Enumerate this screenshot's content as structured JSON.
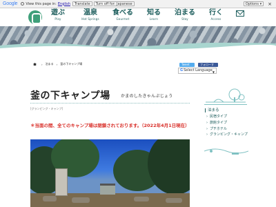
{
  "translate_bar": {
    "google": "Google",
    "view_text": "View this page in:",
    "language": "English",
    "translate_label": "Translate",
    "turn_off_label": "Turn off for: Japanese",
    "options_label": "Options ▾",
    "close_label": "×"
  },
  "nav": {
    "items": [
      {
        "jp": "遊ぶ",
        "en": "Play"
      },
      {
        "jp": "温泉",
        "en": "Hot Springs"
      },
      {
        "jp": "食べる",
        "en": "Gourmet"
      },
      {
        "jp": "知る",
        "en": "Learn"
      },
      {
        "jp": "泊まる",
        "en": "Stay"
      },
      {
        "jp": "行く",
        "en": "Access"
      }
    ]
  },
  "breadcrumb": {
    "parent": "泊まる",
    "current": "釜の下キャンプ場"
  },
  "share": {
    "tweet": "Tweet",
    "facebook": "フォローする"
  },
  "language_select": {
    "value": "Select Language",
    "google_g": "G"
  },
  "page": {
    "title": "釜の下キャンプ場",
    "title_kana": "かまのしたきゃんぷじょう",
    "category": "[グランピング・キャンプ]",
    "notice": "＊当面の間、全てのキャンプ場は閉鎖されております。（2022年4月1日現在）"
  },
  "sidebar": {
    "heading": "泊まる",
    "items": [
      "民宿タイプ",
      "旅館タイプ",
      "プチホテル",
      "グランピング・キャンプ"
    ]
  },
  "colors": {
    "brand_teal": "#1c5d5c",
    "logo_green": "#3fa07a",
    "notice_red": "#d9302a"
  }
}
